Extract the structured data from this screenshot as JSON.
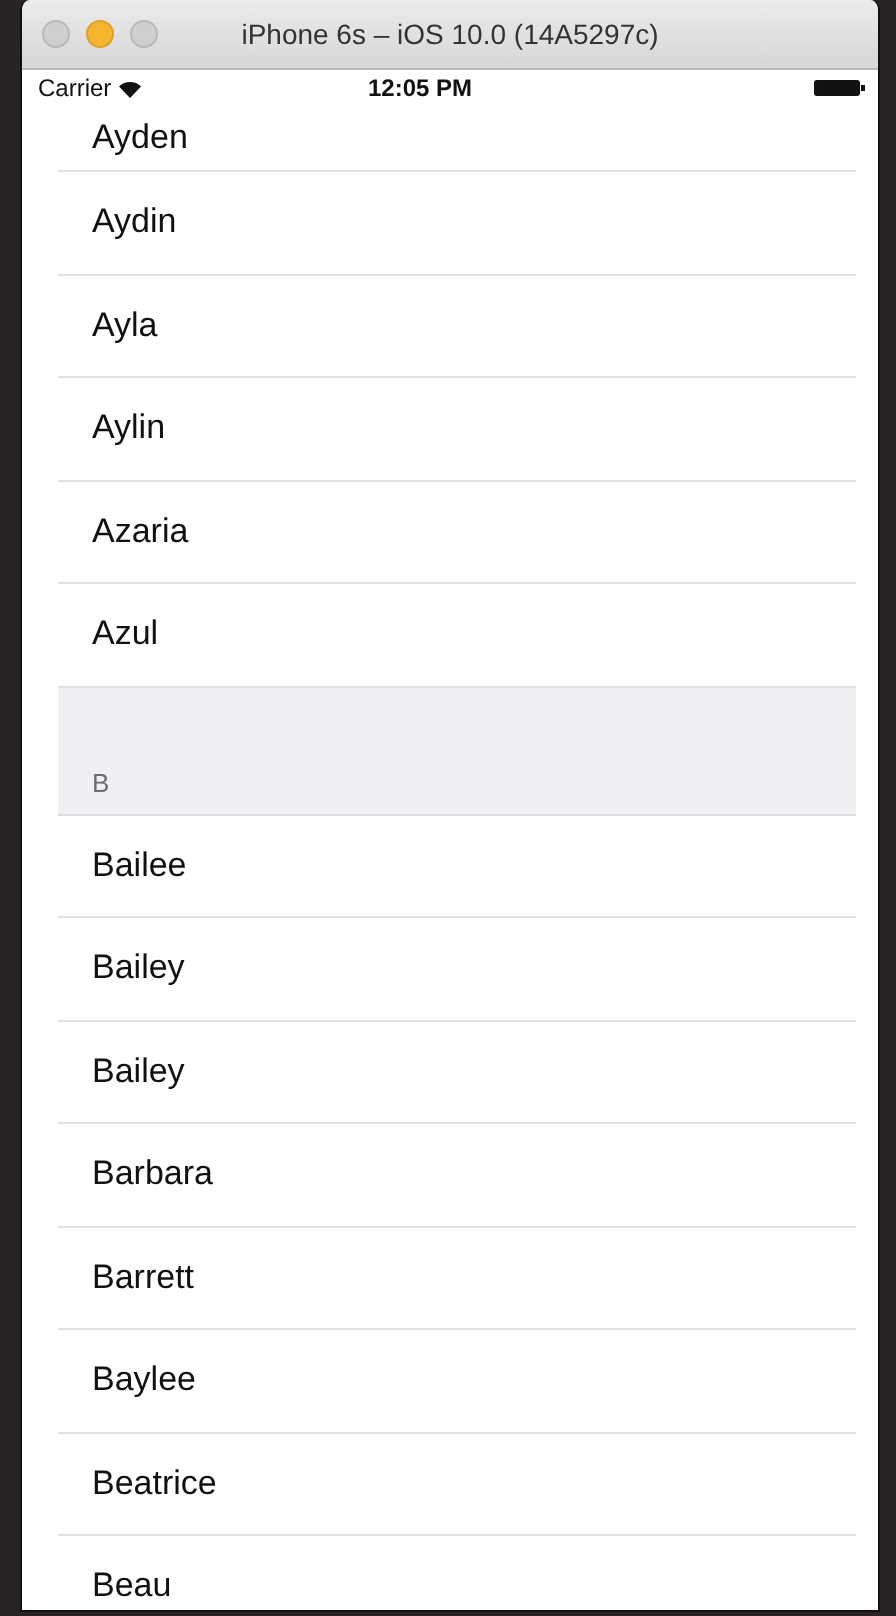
{
  "window": {
    "title": "iPhone 6s – iOS 10.0 (14A5297c)"
  },
  "status_bar": {
    "carrier": "Carrier",
    "time": "12:05 PM"
  },
  "sections": [
    {
      "rows": [
        "Ayden",
        "Aydin",
        "Ayla",
        "Aylin",
        "Azaria",
        "Azul"
      ]
    },
    {
      "header": "B",
      "rows": [
        "Bailee",
        "Bailey",
        "Bailey",
        "Barbara",
        "Barrett",
        "Baylee",
        "Beatrice",
        "Beau"
      ]
    }
  ]
}
